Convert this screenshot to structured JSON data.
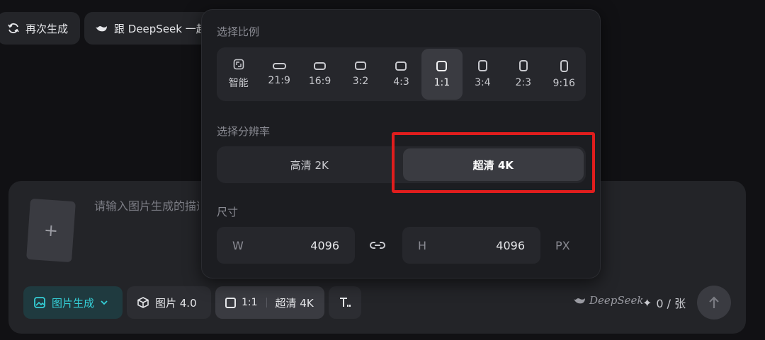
{
  "top_chips": {
    "regenerate_label": "再次生成",
    "deepseek_label": "跟 DeepSeek 一起"
  },
  "input": {
    "placeholder": "请输入图片生成的描述"
  },
  "toolbar": {
    "mode_label": "图片生成",
    "model_label": "图片 4.0",
    "ratio_label": "1:1",
    "resolution_label": "超清 4K",
    "brand_label": "DeepSeek",
    "credit_label": "0 / 张"
  },
  "popover": {
    "ratio_title": "选择比例",
    "ratios": [
      {
        "label": "智能",
        "icon": "smart-ratio-icon"
      },
      {
        "label": "21:9"
      },
      {
        "label": "16:9"
      },
      {
        "label": "3:2"
      },
      {
        "label": "4:3"
      },
      {
        "label": "1:1",
        "selected": true
      },
      {
        "label": "3:4"
      },
      {
        "label": "2:3"
      },
      {
        "label": "9:16"
      }
    ],
    "resolution_title": "选择分辨率",
    "resolutions": [
      {
        "label": "高清 2K"
      },
      {
        "label": "超清 4K",
        "selected": true
      }
    ],
    "size_title": "尺寸",
    "width_label": "W",
    "width_value": "4096",
    "height_label": "H",
    "height_value": "4096",
    "unit": "PX"
  },
  "colors": {
    "accent_teal": "#35d0d8",
    "highlight_red": "#e01d1d",
    "panel_bg": "#1c1d21"
  }
}
